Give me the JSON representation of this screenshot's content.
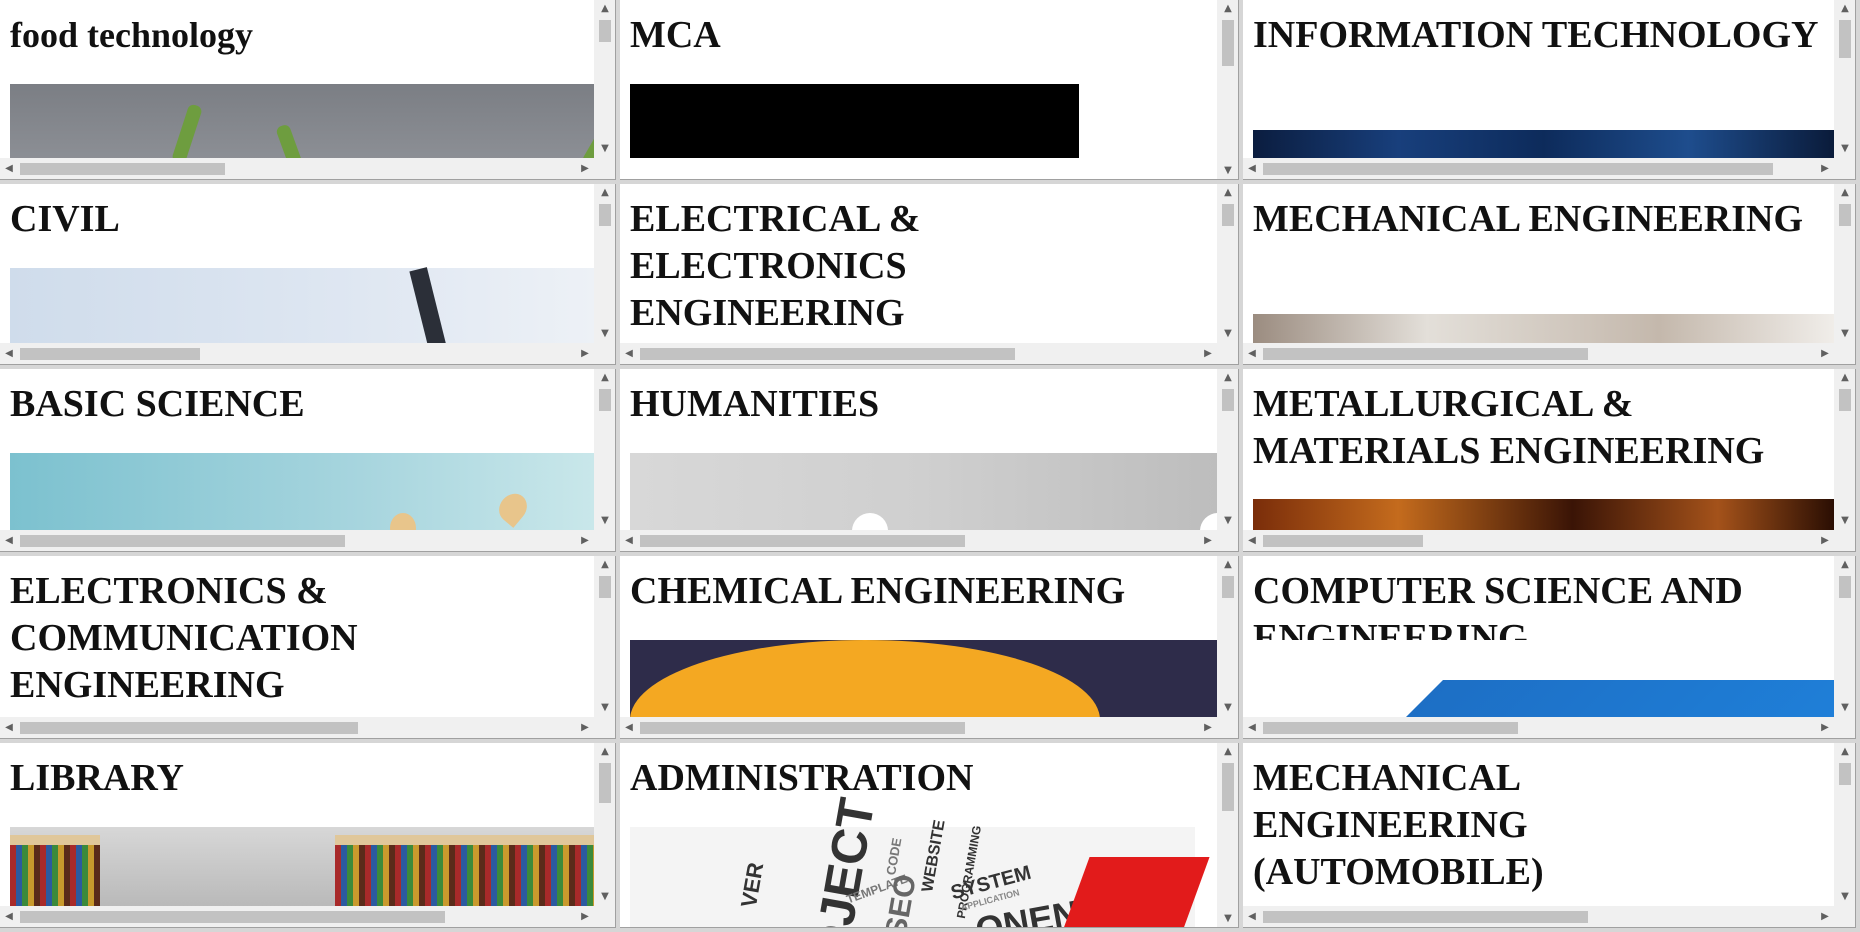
{
  "frames": [
    {
      "title": "food technology",
      "name": "food-technology"
    },
    {
      "title": "MCA",
      "name": "mca"
    },
    {
      "title": "INFORMATION TECHNOLOGY",
      "name": "information-technology"
    },
    {
      "title": "CIVIL",
      "name": "civil"
    },
    {
      "title": "ELECTRICAL & ELECTRONICS ENGINEERING",
      "name": "electrical-electronics"
    },
    {
      "title": "MECHANICAL ENGINEERING",
      "name": "mechanical"
    },
    {
      "title": "BASIC SCIENCE",
      "name": "basic-science"
    },
    {
      "title": "HUMANITIES",
      "name": "humanities"
    },
    {
      "title": "METALLURGICAL & MATERIALS ENGINEERING",
      "name": "metallurgical"
    },
    {
      "title": "ELECTRONICS & COMMUNICATION ENGINEERING",
      "name": "ece"
    },
    {
      "title": "CHEMICAL ENGINEERING",
      "name": "chemical"
    },
    {
      "title": "COMPUTER SCIENCE AND ENGINEERING",
      "name": "cse"
    },
    {
      "title": "LIBRARY",
      "name": "library"
    },
    {
      "title": "ADMINISTRATION",
      "name": "administration"
    },
    {
      "title": "MECHANICAL ENGINEERING (AUTOMOBILE)",
      "name": "mechanical-automobile"
    }
  ],
  "admin_image_words": [
    "VER",
    "OJECT",
    "TEMPLATE",
    "CODE",
    "WEBSITE",
    "SEO",
    "PROGRAMMING",
    "SYSTEM",
    "APPLICATION",
    "ONENT"
  ],
  "scroll_arrows": {
    "up": "▲",
    "down": "▼",
    "left": "◀",
    "right": "▶"
  },
  "colors": {
    "scrollbar_track": "#f0f0f0",
    "scrollbar_thumb": "#c2c2c2",
    "divider": "#d6d6d6"
  }
}
